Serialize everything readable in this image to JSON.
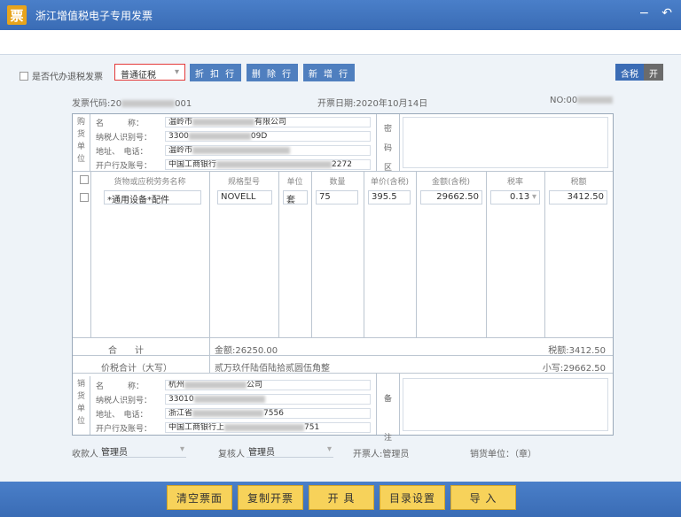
{
  "app": {
    "logo_char": "票",
    "title": "浙江增值税电子专用发票",
    "minimize_glyph": "−",
    "back_glyph": "↶"
  },
  "toolbar": {
    "proxy_checkbox_label": "是否代办退税发票",
    "invoice_type_selected": "普通征税",
    "discount_row": "折 扣 行",
    "delete_row": "删 除 行",
    "add_row": "新 增 行",
    "tax_included_label": "含税",
    "tax_included_state": "开"
  },
  "info": {
    "code_label": "发票代码:20",
    "code_tail": "001",
    "date": "开票日期:2020年10月14日",
    "no_label": "NO:00"
  },
  "buyer": {
    "side_label": [
      "购",
      "货",
      "单",
      "位"
    ],
    "name_label": "名　　　称：",
    "name_value_a": "温岭市",
    "name_value_b": "有限公司",
    "tax_id_label": "纳税人识别号：",
    "tax_id_a": "3300",
    "tax_id_b": "09D",
    "addr_label": "地址、　电话：",
    "addr_a": "温岭市",
    "bank_label": "开户行及账号：",
    "bank_a": "中国工商银行",
    "bank_b": "2272",
    "cipher_labels": [
      "密",
      "码",
      "区"
    ]
  },
  "items": {
    "headers": [
      "货物或应税劳务名称",
      "规格型号",
      "单位",
      "数量",
      "单价(含税)",
      "金额(含税)",
      "税率",
      "税额"
    ],
    "rows": [
      {
        "name": "*通用设备*配件",
        "spec": "NOVELL",
        "unit": "套",
        "qty": "75",
        "price": "395.5",
        "amount": "29662.50",
        "rate": "0.13",
        "tax": "3412.50"
      }
    ]
  },
  "totals": {
    "label": "合　　计",
    "amount": "金额:26250.00",
    "tax": "税额:3412.50",
    "total_label": "价税合计（大写）",
    "total_words": "贰万玖仟陆佰陆拾贰圆伍角整",
    "small_total": "小写:29662.50"
  },
  "seller": {
    "side_label": [
      "销",
      "货",
      "单",
      "位"
    ],
    "name_label": "名　　　称：",
    "name_a": "杭州",
    "name_b": "公司",
    "tax_id_label": "纳税人识别号：",
    "tax_id_a": "33010",
    "addr_label": "地址、　电话：",
    "addr_a": "浙江省",
    "addr_b": "7556",
    "bank_label": "开户行及账号：",
    "bank_a": "中国工商银行上",
    "bank_b": "751",
    "remark_labels": [
      "备",
      "注"
    ]
  },
  "people": {
    "payee_label": "收款人",
    "payee": "管理员",
    "reviewer_label": "复核人",
    "reviewer": "管理员",
    "issuer": "开票人:管理员",
    "seller_unit": "销货单位：（章）"
  },
  "footer": {
    "clear": "清空票面",
    "copy": "复制开票",
    "issue": "开 具",
    "catalog": "目录设置",
    "import": "导 入"
  }
}
